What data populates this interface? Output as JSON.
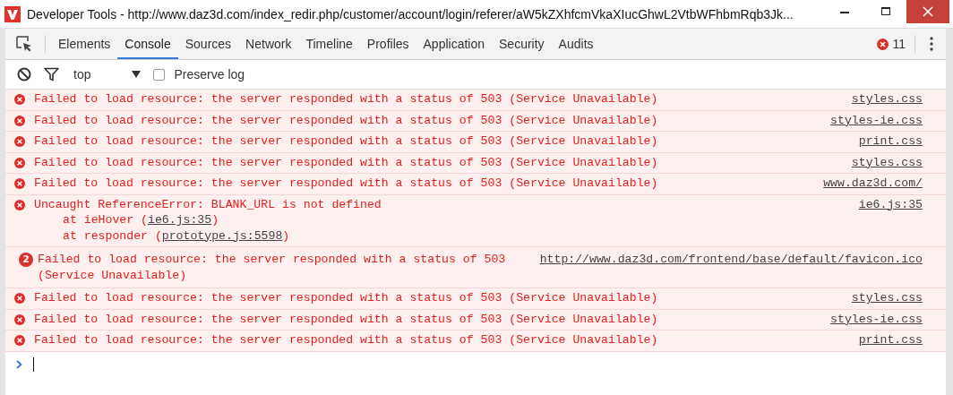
{
  "window": {
    "title": "Developer Tools - http://www.daz3d.com/index_redir.php/customer/account/login/referer/aW5kZXhfcmVkaXIucGhwL2VtbWFhbmRqb3Jk..."
  },
  "tabs": [
    {
      "label": "Elements",
      "selected": false
    },
    {
      "label": "Console",
      "selected": true
    },
    {
      "label": "Sources",
      "selected": false
    },
    {
      "label": "Network",
      "selected": false
    },
    {
      "label": "Timeline",
      "selected": false
    },
    {
      "label": "Profiles",
      "selected": false
    },
    {
      "label": "Application",
      "selected": false
    },
    {
      "label": "Security",
      "selected": false
    },
    {
      "label": "Audits",
      "selected": false
    }
  ],
  "error_count": "11",
  "toolbar": {
    "context": "top",
    "preserve_log": {
      "label": "Preserve log",
      "checked": false
    }
  },
  "messages": [
    {
      "kind": "error",
      "text": "Failed to load resource: the server responded with a status of 503 (Service Unavailable)",
      "source": "styles.css"
    },
    {
      "kind": "error",
      "text": "Failed to load resource: the server responded with a status of 503 (Service Unavailable)",
      "source": "styles-ie.css"
    },
    {
      "kind": "error",
      "text": "Failed to load resource: the server responded with a status of 503 (Service Unavailable)",
      "source": "print.css"
    },
    {
      "kind": "error",
      "text": "Failed to load resource: the server responded with a status of 503 (Service Unavailable)",
      "source": "styles.css"
    },
    {
      "kind": "error",
      "text": "Failed to load resource: the server responded with a status of 503 (Service Unavailable)",
      "source": "www.daz3d.com/"
    },
    {
      "kind": "stack",
      "text": "Uncaught ReferenceError: BLANK_URL is not defined",
      "source": "ie6.js:35",
      "frames": [
        {
          "text": "at ieHover (",
          "link": "ie6.js:35",
          "end": ")"
        },
        {
          "text": "at responder (",
          "link": "prototype.js:5598",
          "end": ")"
        }
      ]
    },
    {
      "kind": "repeated",
      "count": "2",
      "lines": [
        "Failed to load resource: the server responded with a status of 503",
        "(Service Unavailable)"
      ],
      "source": "http://www.daz3d.com/frontend/base/default/favicon.ico"
    },
    {
      "kind": "error",
      "text": "Failed to load resource: the server responded with a status of 503 (Service Unavailable)",
      "source": "styles.css"
    },
    {
      "kind": "error",
      "text": "Failed to load resource: the server responded with a status of 503 (Service Unavailable)",
      "source": "styles-ie.css"
    },
    {
      "kind": "error",
      "text": "Failed to load resource: the server responded with a status of 503 (Service Unavailable)",
      "source": "print.css"
    }
  ]
}
